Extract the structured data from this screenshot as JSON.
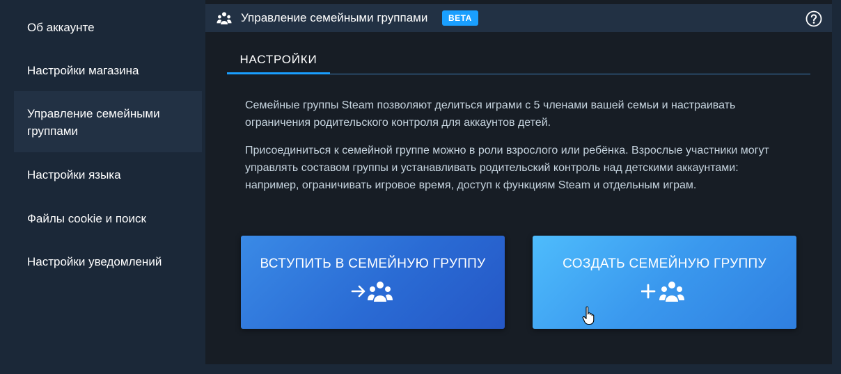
{
  "sidebar": {
    "items": [
      {
        "label": "Об аккаунте"
      },
      {
        "label": "Настройки магазина"
      },
      {
        "label": "Управление семейными группами",
        "active": true
      },
      {
        "label": "Настройки языка"
      },
      {
        "label": "Файлы cookie и поиск"
      },
      {
        "label": "Настройки уведомлений"
      }
    ]
  },
  "header": {
    "icon": "family-group-icon",
    "title": "Управление семейными группами",
    "badge": "BETA",
    "help_icon": "help-circle-icon"
  },
  "tabs": [
    {
      "label": "НАСТРОЙКИ",
      "active": true
    }
  ],
  "content": {
    "paragraph1": "Семейные группы Steam позволяют делиться играми с 5 членами вашей семьи и настраивать ограничения родительского контроля для аккаунтов детей.",
    "paragraph2": "Присоединиться к семейной группе можно в роли взрослого или ребёнка. Взрослые участники могут управлять составом группы и устанавливать родительский контроль над детскими аккаунтами: например, ограничивать игровое время, доступ к функциям Steam и отдельным играм."
  },
  "actions": {
    "join": {
      "label": "ВСТУПИТЬ В СЕМЕЙНУЮ ГРУППУ",
      "icon": "arrow-join-group-icon"
    },
    "create": {
      "label": "СОЗДАТЬ СЕМЕЙНУЮ ГРУППУ",
      "icon": "plus-create-group-icon"
    }
  },
  "colors": {
    "background": "#1b2838",
    "panel": "#171d25",
    "header": "#223144",
    "accent": "#1a9fff",
    "text": "#c6d4df"
  }
}
